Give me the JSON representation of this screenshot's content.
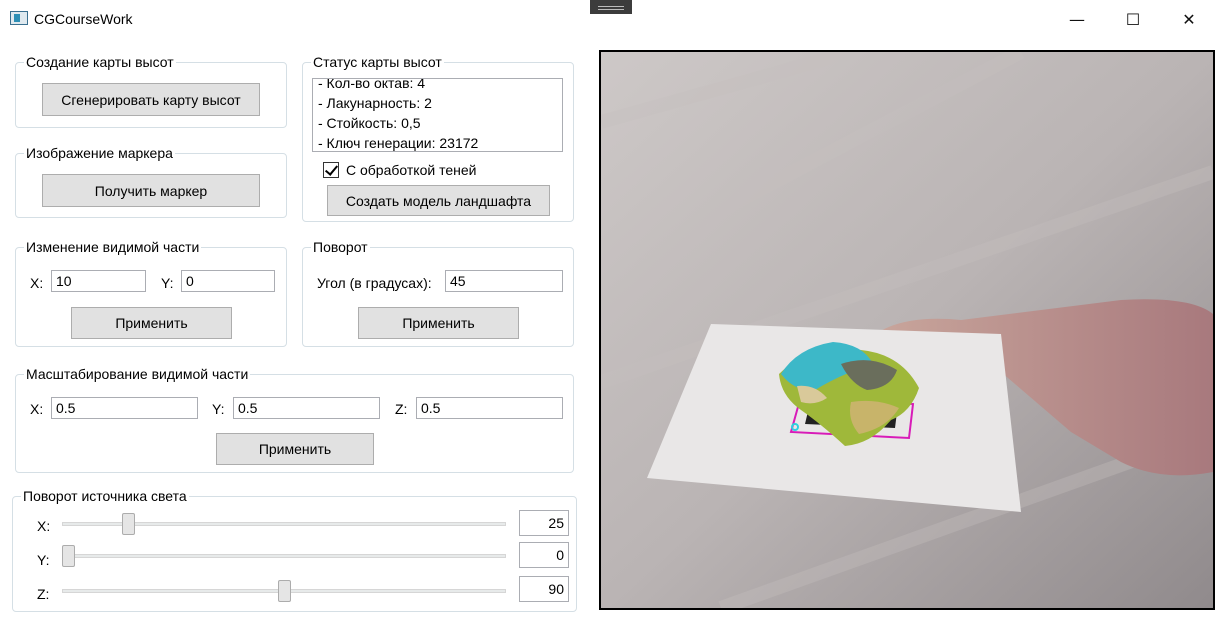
{
  "window": {
    "title": "CGCourseWork",
    "controls": {
      "minimize": "—",
      "maximize": "☐",
      "close": "✕"
    }
  },
  "heightmap_create": {
    "legend": "Создание карты высот",
    "generate_button": "Сгенерировать карту высот"
  },
  "marker": {
    "legend": "Изображение маркера",
    "get_button": "Получить маркер"
  },
  "heightmap_status": {
    "legend": "Статус карты высот",
    "items": [
      "- Кол-во октав: 4",
      "- Лакунарность: 2",
      "- Стойкость: 0,5",
      "- Ключ генерации: 23172"
    ],
    "shadows_checkbox": {
      "label": "С обработкой теней",
      "checked": true
    },
    "create_model_button": "Создать модель ландшафта"
  },
  "visible_change": {
    "legend": "Изменение видимой части",
    "x_label": "X:",
    "x_value": "10",
    "y_label": "Y:",
    "y_value": "0",
    "apply_button": "Применить"
  },
  "rotation": {
    "legend": "Поворот",
    "angle_label": "Угол (в градусах):",
    "angle_value": "45",
    "apply_button": "Применить"
  },
  "scaling": {
    "legend": "Масштабирование видимой части",
    "x_label": "X:",
    "x_value": "0.5",
    "y_label": "Y:",
    "y_value": "0.5",
    "z_label": "Z:",
    "z_value": "0.5",
    "apply_button": "Применить"
  },
  "light_rotation": {
    "legend": "Поворот источника света",
    "sliders": [
      {
        "label": "X:",
        "value": "25",
        "fraction": 0.14
      },
      {
        "label": "Y:",
        "value": "0",
        "fraction": 0.0
      },
      {
        "label": "Z:",
        "value": "90",
        "fraction": 0.5
      }
    ]
  },
  "colors": {
    "button_bg": "#e1e1e1",
    "group_border": "#d5dfe5",
    "marker_outline": "#d81bb8"
  }
}
